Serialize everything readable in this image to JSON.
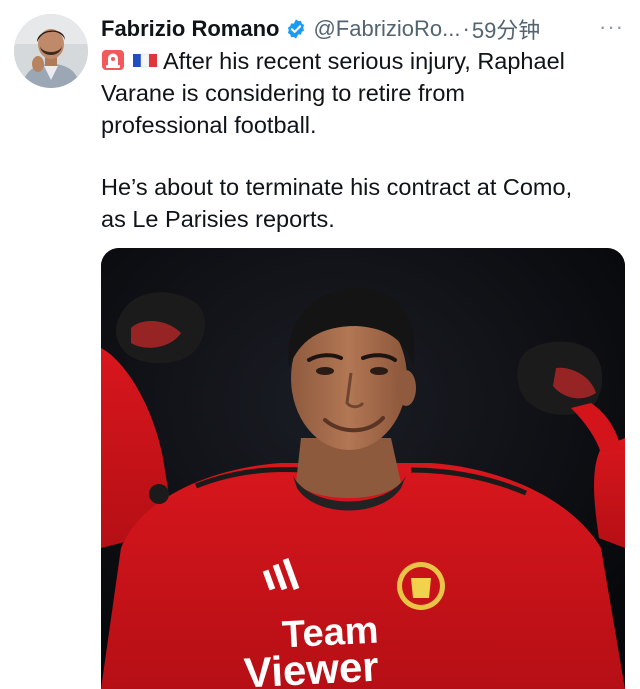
{
  "tweet": {
    "author_name": "Fabrizio Romano",
    "handle": "@FabrizioRo...",
    "separator": "·",
    "time": "59分钟",
    "more": "···",
    "text_line1": "After his recent serious injury, Raphael",
    "text_line2": "Varane is considering to retire from",
    "text_line3": "professional football.",
    "text_line4": "He’s about to terminate his contract at Como,",
    "text_line5": "as Le Parisies reports.",
    "emojis": [
      "siren-emoji",
      "france-flag-emoji"
    ]
  },
  "media": {
    "sponsor_line1": "Team",
    "sponsor_line2": "Viewer",
    "colors": {
      "background": "#0b0c10",
      "shirt_red": "#d3141b",
      "glove_dark": "#1a1a1a",
      "skin": "#a56b4b"
    }
  },
  "colors": {
    "text": "#0f1419",
    "secondary": "#536471",
    "verified_blue": "#1d9bf0"
  }
}
